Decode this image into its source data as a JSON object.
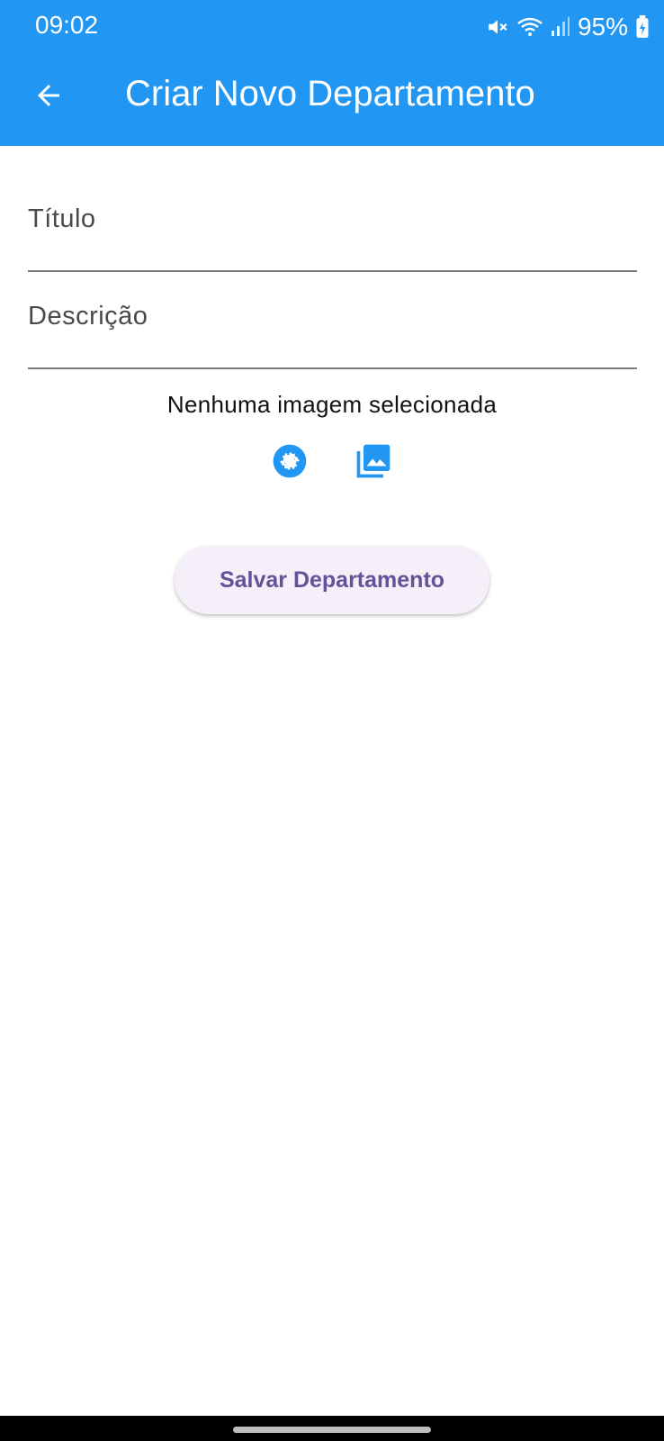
{
  "status_bar": {
    "time": "09:02",
    "battery": "95%",
    "icons": [
      "mute-icon",
      "wifi-icon",
      "signal-icon",
      "battery-charging-icon"
    ]
  },
  "app_bar": {
    "title": "Criar Novo Departamento",
    "back_icon": "arrow-back-icon",
    "color": "#2196F3"
  },
  "form": {
    "titulo_placeholder": "Título",
    "titulo_value": "",
    "descricao_placeholder": "Descrição",
    "descricao_value": ""
  },
  "image": {
    "status_text": "Nenhuma imagem selecionada",
    "camera_icon": "camera-icon",
    "gallery_icon": "gallery-icon",
    "icon_color": "#2196F3"
  },
  "actions": {
    "save_label": "Salvar Departamento"
  }
}
